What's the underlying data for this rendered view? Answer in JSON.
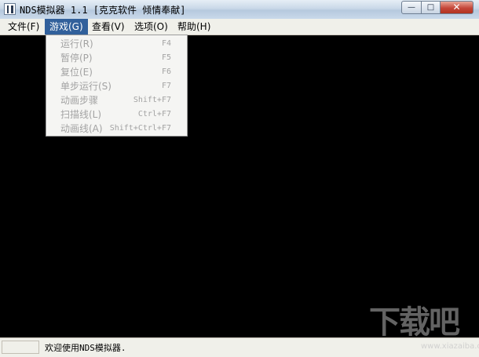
{
  "window": {
    "title": "NDS模拟器 1.1 [克克软件 倾情奉献]",
    "controls": {
      "minimize": "—",
      "maximize": "□",
      "close": "✕"
    }
  },
  "menubar": {
    "items": [
      {
        "label": "文件(F)"
      },
      {
        "label": "游戏(G)"
      },
      {
        "label": "查看(V)"
      },
      {
        "label": "选项(O)"
      },
      {
        "label": "帮助(H)"
      }
    ],
    "active_index": 1
  },
  "game_menu": {
    "items": [
      {
        "label": "运行(R)",
        "shortcut": "F4",
        "enabled": false
      },
      {
        "label": "暂停(P)",
        "shortcut": "F5",
        "enabled": false
      },
      {
        "label": "复位(E)",
        "shortcut": "F6",
        "enabled": false
      },
      {
        "label": "单步运行(S)",
        "shortcut": "F7",
        "enabled": false
      },
      {
        "label": "动画步骤",
        "shortcut": "Shift+F7",
        "enabled": false
      },
      {
        "label": "扫描线(L)",
        "shortcut": "Ctrl+F7",
        "enabled": false
      },
      {
        "label": "动画线(A)",
        "shortcut": "Shift+Ctrl+F7",
        "enabled": false
      }
    ]
  },
  "statusbar": {
    "message": "欢迎使用NDS模拟器."
  },
  "watermark": {
    "logo_text": "下载吧",
    "url": "www.xiazaiba.com"
  },
  "colors": {
    "menu_highlight": "#31609b",
    "disabled_text": "#a3a3a3",
    "screen_background": "#000000"
  }
}
